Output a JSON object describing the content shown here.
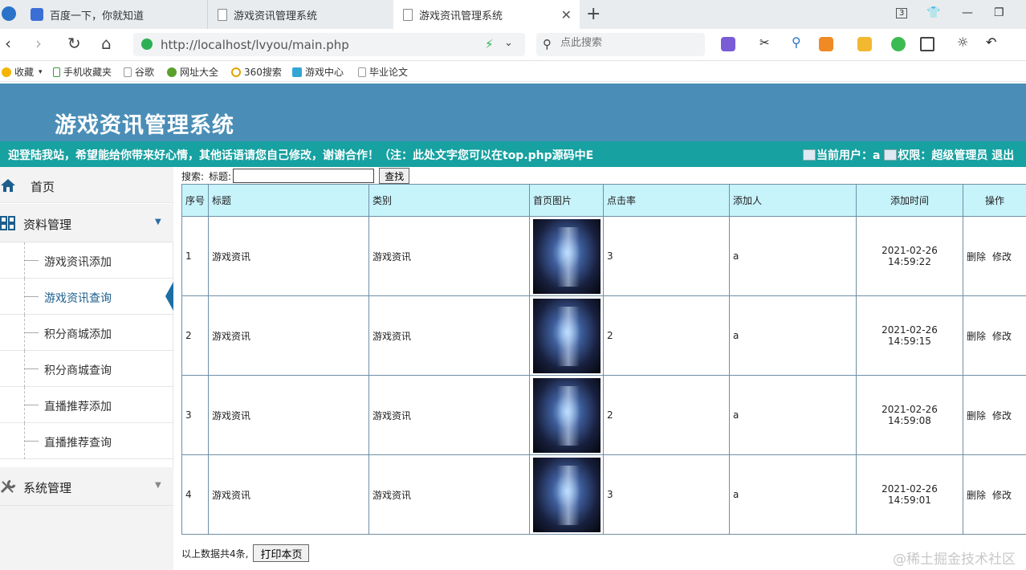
{
  "browser": {
    "tabs": [
      {
        "title": "百度一下，你就知道",
        "icon": "baidu-paw-icon"
      },
      {
        "title": "游戏资讯管理系统",
        "icon": "page-icon"
      },
      {
        "title": "游戏资讯管理系统",
        "icon": "page-icon",
        "active": true
      }
    ],
    "address": "http://localhost/lvyou/main.php",
    "search_placeholder": "点此搜索",
    "bookmarks": [
      "收藏",
      "手机收藏夹",
      "谷歌",
      "网址大全",
      "360搜索",
      "游戏中心",
      "毕业论文"
    ],
    "tab_counter": "3",
    "colors": {
      "accent_green": "#2eaf54"
    }
  },
  "app": {
    "title": "游戏资讯管理系统",
    "marquee": "迎登陆我站，希望能给你带来好心情，其他话语请您自己修改，谢谢合作！（注：此处文字您可以在top.php源码中E",
    "current_user_label": "当前用户：a",
    "permission_label": "权限：超级管理员",
    "logout_label": "退出",
    "colors": {
      "header": "#4a8eb7",
      "bar": "#17a1a1",
      "table_header": "#c7f3fb"
    }
  },
  "sidebar": {
    "home": "首页",
    "groups": [
      {
        "label": "资料管理",
        "items": [
          "游戏资讯添加",
          "游戏资讯查询",
          "积分商城添加",
          "积分商城查询",
          "直播推荐添加",
          "直播推荐查询"
        ],
        "active_item": "游戏资讯查询"
      },
      {
        "label": "系统管理",
        "items": []
      }
    ]
  },
  "main": {
    "search_label": "搜索:",
    "title_label": "标题:",
    "title_value": "",
    "search_button": "查找",
    "columns": [
      "序号",
      "标题",
      "类别",
      "首页图片",
      "点击率",
      "添加人",
      "添加时间",
      "操作"
    ],
    "rows": [
      {
        "no": "1",
        "title": "游戏资讯",
        "category": "游戏资讯",
        "clicks": "3",
        "adder": "a",
        "date": "2021-02-26",
        "time": "14:59:22"
      },
      {
        "no": "2",
        "title": "游戏资讯",
        "category": "游戏资讯",
        "clicks": "2",
        "adder": "a",
        "date": "2021-02-26",
        "time": "14:59:15"
      },
      {
        "no": "3",
        "title": "游戏资讯",
        "category": "游戏资讯",
        "clicks": "2",
        "adder": "a",
        "date": "2021-02-26",
        "time": "14:59:08"
      },
      {
        "no": "4",
        "title": "游戏资讯",
        "category": "游戏资讯",
        "clicks": "3",
        "adder": "a",
        "date": "2021-02-26",
        "time": "14:59:01"
      }
    ],
    "op_delete": "删除",
    "op_edit": "修改",
    "total_text": "以上数据共4条,",
    "print_button": "打印本页"
  },
  "watermark": "@稀土掘金技术社区"
}
